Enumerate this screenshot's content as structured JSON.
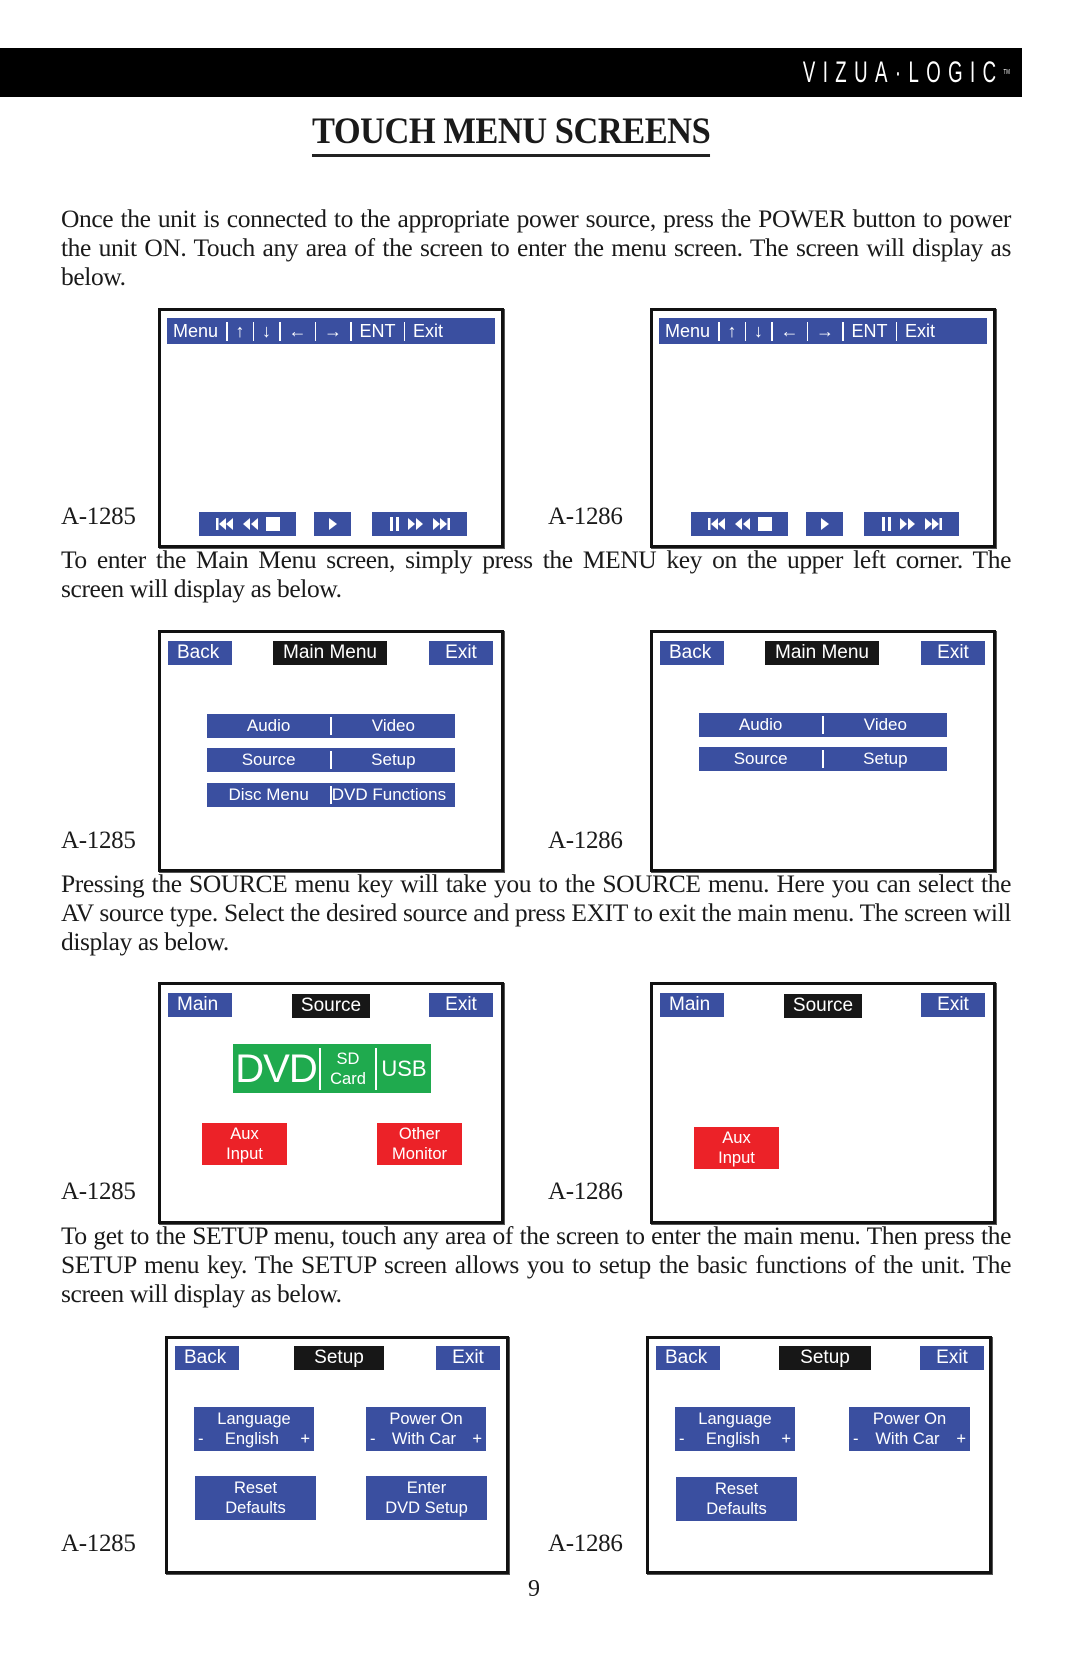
{
  "header": {
    "brand": "VIZUA·LOGIC",
    "trademark": "TM"
  },
  "title": "TOUCH MENU SCREENS",
  "paragraphs": [
    "Once the unit is connected to the appropriate power source, press the POWER button to power the unit ON.  Touch any area of the screen to enter the menu screen.  The screen will display as below.",
    "To enter the Main Menu screen, simply press the MENU key on the upper left corner. The screen will display as below.",
    "Pressing the SOURCE menu key will take you to the SOURCE menu.  Here you can select the AV source type. Select the desired source and press EXIT to exit the main menu.  The screen will display as below.",
    "To get to the SETUP menu, touch any area of the screen to enter the main menu.  Then press the SETUP menu key.  The SETUP screen allows you to setup the basic functions of the unit. The screen will display as below."
  ],
  "models": {
    "left": "A-1285",
    "right": "A-1286"
  },
  "colors": {
    "blue": "#3a4fa0",
    "black": "#171717",
    "green": "#1faa4e",
    "red": "#ec2228"
  },
  "initial_screen": {
    "nav": [
      "Menu",
      "↑",
      "↓",
      "←",
      "→",
      "ENT",
      "Exit"
    ],
    "controls": [
      {
        "icons": [
          "skip-back-icon",
          "rewind-icon",
          "stop-icon"
        ]
      },
      {
        "icons": [
          "play-icon"
        ]
      },
      {
        "icons": [
          "pause-icon",
          "fast-forward-icon",
          "skip-forward-icon"
        ]
      }
    ]
  },
  "main_menu": {
    "back": "Back",
    "title": "Main Menu",
    "exit": "Exit",
    "rows": [
      [
        "Audio",
        "Video"
      ],
      [
        "Source",
        "Setup"
      ],
      [
        "Disc Menu",
        "DVD Functions"
      ]
    ]
  },
  "source_menu": {
    "main": "Main",
    "title": "Source",
    "exit": "Exit",
    "dvd": "DVD",
    "sd_line1": "SD",
    "sd_line2": "Card",
    "usb": "USB",
    "aux_line1": "Aux",
    "aux_line2": "Input",
    "other_line1": "Other",
    "other_line2": "Monitor"
  },
  "setup_menu": {
    "back": "Back",
    "title": "Setup",
    "exit": "Exit",
    "language_label": "Language",
    "language_minus": "-",
    "language_value": "English",
    "language_plus": "+",
    "power_label": "Power On",
    "power_minus": "-",
    "power_value": "With Car",
    "power_plus": "+",
    "reset_line1": "Reset",
    "reset_line2": "Defaults",
    "dvd_line1": "Enter",
    "dvd_line2": "DVD Setup"
  },
  "page_number": "9"
}
